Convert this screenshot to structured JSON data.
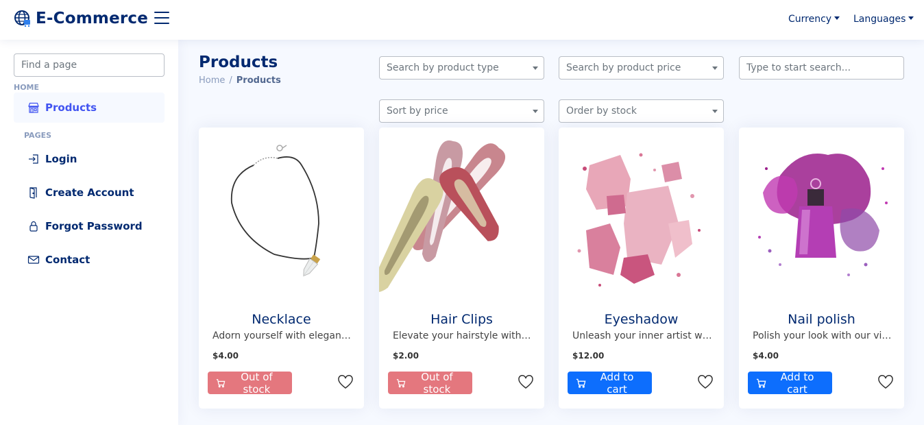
{
  "header": {
    "brand": "E-Commerce",
    "nav": [
      {
        "label": "Currency"
      },
      {
        "label": "Languages"
      }
    ]
  },
  "sidebar": {
    "search_placeholder": "Find a page",
    "home_heading": "HOME",
    "pages_heading": "PAGES",
    "items": [
      {
        "label": "Products",
        "icon": "shop-icon",
        "active": true
      },
      {
        "label": "Login",
        "icon": "login-icon"
      },
      {
        "label": "Create Account",
        "icon": "door-icon"
      },
      {
        "label": "Forgot Password",
        "icon": "lock-icon"
      },
      {
        "label": "Contact",
        "icon": "envelope-icon"
      }
    ]
  },
  "main": {
    "title": "Products",
    "breadcrumb": {
      "home": "Home",
      "separator": "/",
      "current": "Products"
    },
    "filters": {
      "product_type": "Search by product type",
      "product_price": "Search by product price",
      "search_placeholder": "Type to start search...",
      "sort_price": "Sort by price",
      "order_stock": "Order by stock"
    },
    "products": [
      {
        "name": "Necklace",
        "description": "Adorn yourself with elegance...",
        "price": "$4.00",
        "button": "Out of stock",
        "in_stock": false
      },
      {
        "name": "Hair Clips",
        "description": "Elevate your hairstyle with o...",
        "price": "$2.00",
        "button": "Out of stock",
        "in_stock": false
      },
      {
        "name": "Eyeshadow",
        "description": "Unleash your inner artist wit...",
        "price": "$12.00",
        "button": "Add to cart",
        "in_stock": true
      },
      {
        "name": "Nail polish",
        "description": "Polish your look with our vibr...",
        "price": "$4.00",
        "button": "Add to cart",
        "in_stock": true
      }
    ]
  },
  "colors": {
    "navy": "#012970",
    "accent": "#4154f1",
    "out_of_stock": "#e4777e",
    "add_to_cart": "#0d6efd"
  }
}
